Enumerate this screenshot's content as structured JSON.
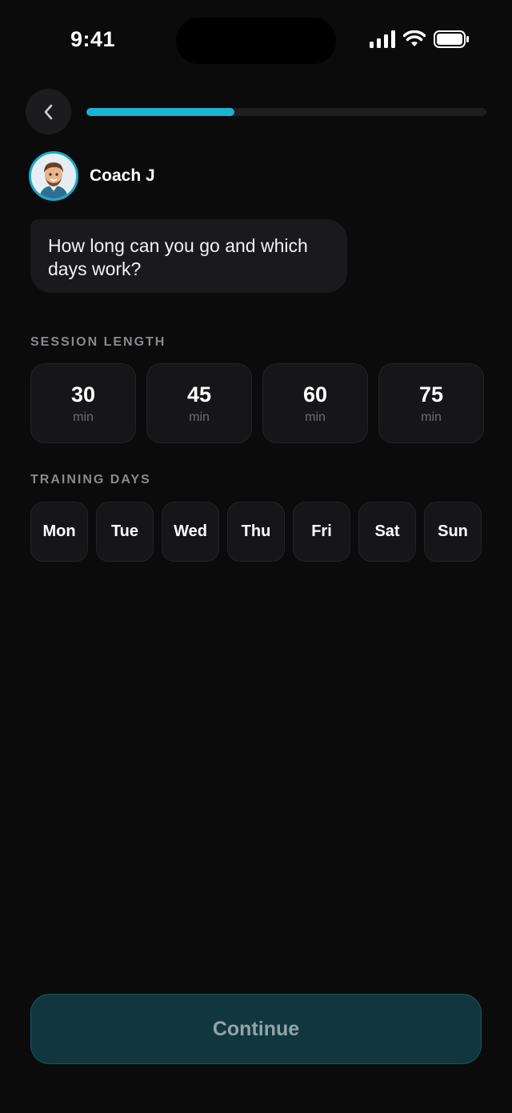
{
  "status_bar": {
    "time": "9:41"
  },
  "progress": {
    "fraction": 0.37
  },
  "coach": {
    "name": "Coach J"
  },
  "message": {
    "text": "How long can you go and which days work?"
  },
  "session_length": {
    "label": "SESSION LENGTH",
    "options": [
      {
        "value": "30",
        "unit": "min"
      },
      {
        "value": "45",
        "unit": "min"
      },
      {
        "value": "60",
        "unit": "min"
      },
      {
        "value": "75",
        "unit": "min"
      }
    ]
  },
  "training_days": {
    "label": "TRAINING DAYS",
    "days": [
      "Mon",
      "Tue",
      "Wed",
      "Thu",
      "Fri",
      "Sat",
      "Sun"
    ]
  },
  "continue_button": {
    "label": "Continue"
  },
  "colors": {
    "accent": "#1ab3d4",
    "background": "#0b0b0c",
    "card": "#161618",
    "button_bg": "#12363d"
  }
}
